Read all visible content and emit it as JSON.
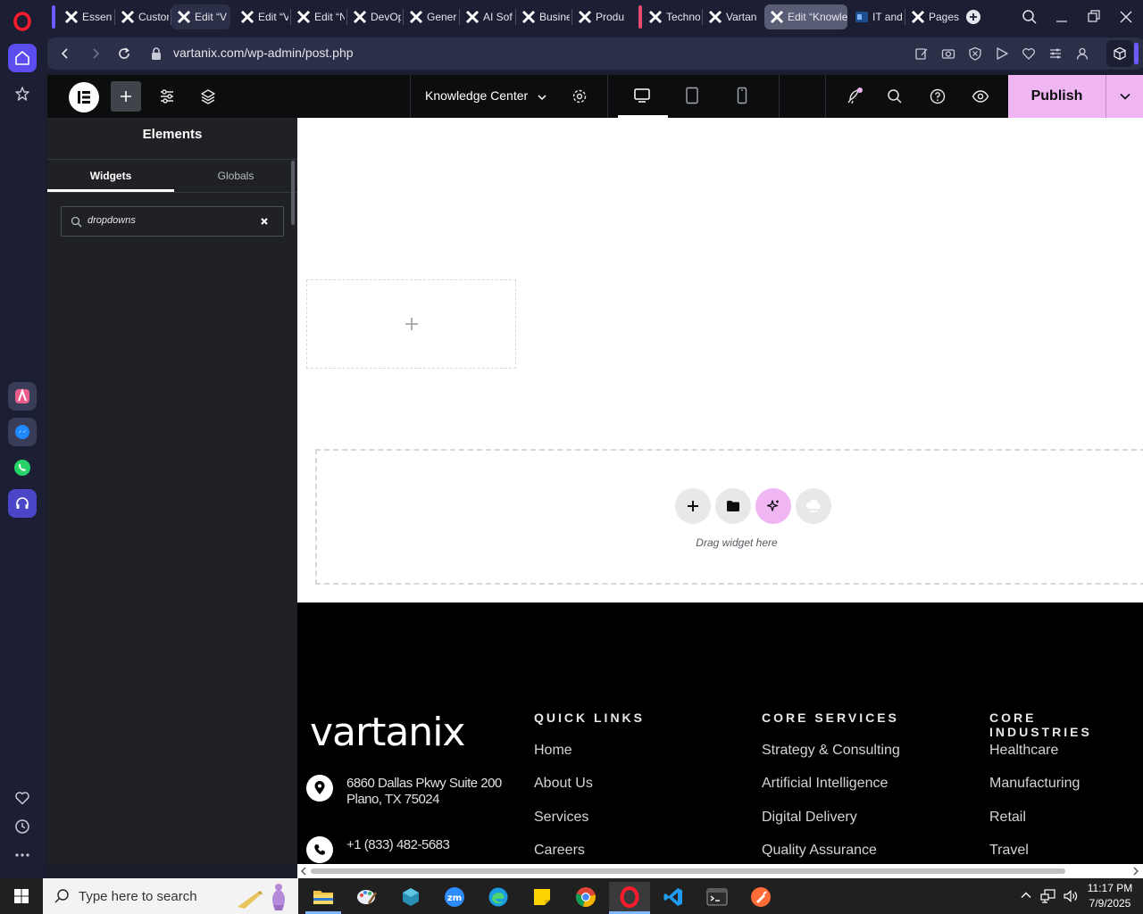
{
  "browser": {
    "tabs": [
      {
        "label": "Essent"
      },
      {
        "label": "Custor"
      },
      {
        "label": "Edit “V"
      },
      {
        "label": "Edit “V"
      },
      {
        "label": "Edit “N"
      },
      {
        "label": "DevOp"
      },
      {
        "label": "Gener"
      },
      {
        "label": "AI Sof"
      },
      {
        "label": "Busine"
      },
      {
        "label": "Produ"
      },
      {
        "label": "Techno"
      },
      {
        "label": "Vartan"
      },
      {
        "label": "Edit “Knowle"
      },
      {
        "label": "IT and"
      },
      {
        "label": "Pages"
      }
    ],
    "url": "vartanix.com/wp-admin/post.php"
  },
  "editor": {
    "page_name": "Knowledge Center",
    "publish_label": "Publish"
  },
  "panel": {
    "title": "Elements",
    "tabs": [
      "Widgets",
      "Globals"
    ],
    "search_value": "dropdowns"
  },
  "canvas": {
    "drag_hint": "Drag widget here"
  },
  "footer": {
    "logo_text": "vartanix",
    "address_line1": "6860 Dallas Pkwy Suite 200",
    "address_line2": "Plano, TX 75024",
    "phone": "+1 (833) 482-5683",
    "quick_links": {
      "heading": "QUICK LINKS",
      "items": [
        "Home",
        "About Us",
        "Services",
        "Careers"
      ]
    },
    "core_services": {
      "heading": "CORE SERVICES",
      "items": [
        "Strategy & Consulting",
        "Artificial Intelligence",
        "Digital Delivery",
        "Quality Assurance"
      ]
    },
    "core_industries": {
      "heading": "CORE INDUSTRIES",
      "items": [
        "Healthcare",
        "Manufacturing",
        "Retail",
        "Travel"
      ]
    }
  },
  "taskbar": {
    "search_placeholder": "Type here to search",
    "time": "11:17 PM",
    "date": "7/9/2025"
  },
  "colors": {
    "accent_pink": "#f0b6f3",
    "browser_bg": "#1c1f33",
    "editor_bg": "#0c0d0e",
    "panel_bg": "#1f2124"
  }
}
